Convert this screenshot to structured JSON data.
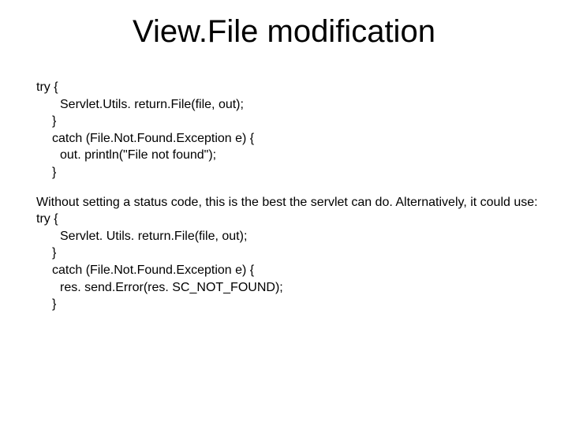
{
  "title": "View.File modification",
  "code1": {
    "l1": "try {",
    "l2": "Servlet.Utils. return.File(file, out);",
    "l3": "}",
    "l4": "catch (File.Not.Found.Exception e) {",
    "l5": "out. println(\"File not found\");",
    "l6": "}"
  },
  "para": "Without setting a status code, this is the best the servlet can do.  Alternatively, it could use:",
  "code2": {
    "l1": "try {",
    "l2": "Servlet. Utils. return.File(file, out);",
    "l3": "}",
    "l4": "catch (File.Not.Found.Exception e) {",
    "l5": "res. send.Error(res. SC_NOT_FOUND);",
    "l6": "}"
  }
}
